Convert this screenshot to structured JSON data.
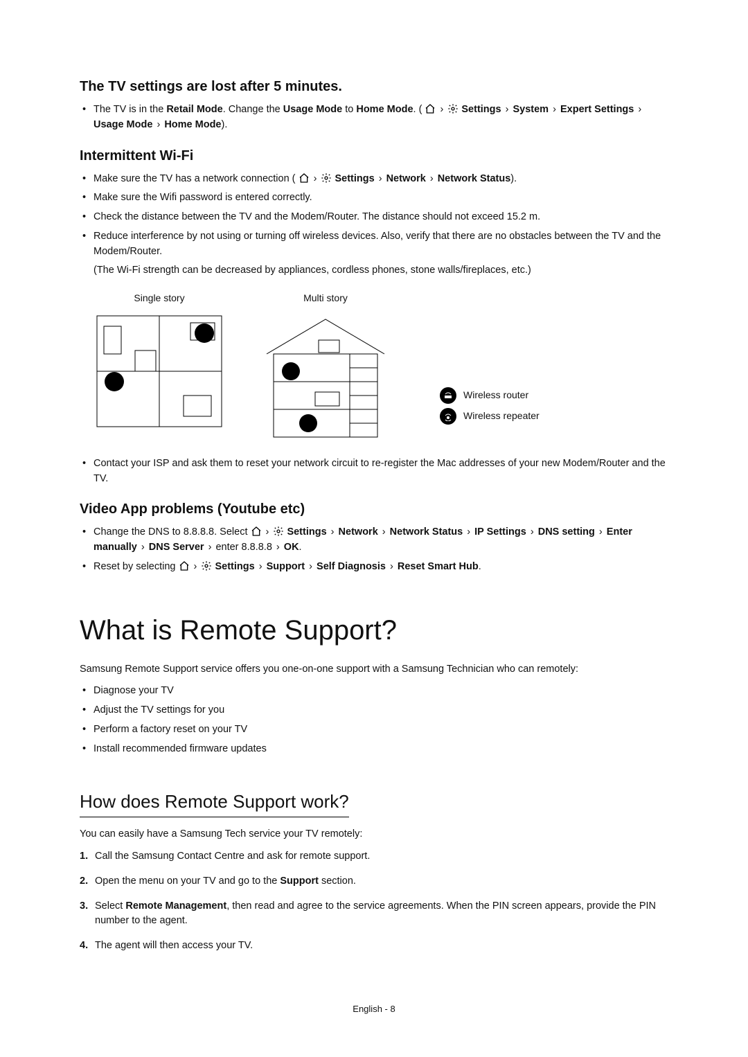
{
  "section1": {
    "heading": "The TV settings are lost after 5 minutes.",
    "bullets": [
      {
        "pre": "The TV is in the ",
        "b1": "Retail Mode",
        "mid1": ". Change the ",
        "b2": "Usage Mode",
        "mid2": " to ",
        "b3": "Home Mode",
        "mid3": ". (",
        "path": [
          "Settings",
          "System",
          "Expert Settings",
          "Usage Mode",
          "Home Mode"
        ],
        "post": ")."
      }
    ]
  },
  "section2": {
    "heading": "Intermittent Wi-Fi",
    "bullets": [
      {
        "pre": "Make sure the TV has a network connection (",
        "path": [
          "Settings",
          "Network",
          "Network Status"
        ],
        "post": ")."
      },
      {
        "text": "Make sure the Wifi password is entered correctly."
      },
      {
        "text": "Check the distance between the TV and the Modem/Router. The distance should not exceed 15.2 m."
      },
      {
        "text": "Reduce interference by not using or turning off wireless devices. Also, verify that there are no obstacles between the TV and the Modem/Router.",
        "sub": "(The Wi-Fi strength can be decreased by appliances, cordless phones, stone walls/fireplaces, etc.)"
      }
    ],
    "diagram_labels": {
      "single": "Single story",
      "multi": "Multi story"
    },
    "legend": {
      "router": "Wireless router",
      "repeater": "Wireless repeater"
    },
    "tail_bullet": "Contact your ISP and ask them to reset your network circuit to re-register the Mac addresses of your new Modem/Router and the TV."
  },
  "section3": {
    "heading": "Video App problems (Youtube etc)",
    "bullets": [
      {
        "pre": "Change the DNS to 8.8.8.8. Select ",
        "path": [
          "Settings",
          "Network",
          "Network Status",
          "IP Settings",
          "DNS setting",
          "Enter manually",
          "DNS Server"
        ],
        "post_pre": " enter 8.8.8.8 ",
        "post_b": "OK",
        "post": "."
      },
      {
        "pre": "Reset by selecting ",
        "path": [
          "Settings",
          "Support",
          "Self Diagnosis",
          "Reset Smart Hub"
        ],
        "post": "."
      }
    ]
  },
  "section4": {
    "heading": "What is Remote Support?",
    "intro": "Samsung Remote Support service offers you one-on-one support with a Samsung Technician who can remotely:",
    "bullets": [
      "Diagnose your TV",
      "Adjust the TV settings for you",
      "Perform a factory reset on your TV",
      "Install recommended firmware updates"
    ]
  },
  "section5": {
    "heading": "How does Remote Support work?",
    "intro": "You can easily have a Samsung Tech service your TV remotely:",
    "steps": [
      {
        "text": "Call the Samsung Contact Centre and ask for remote support."
      },
      {
        "pre": "Open the menu on your TV and go to the ",
        "b": "Support",
        "post": " section."
      },
      {
        "pre": "Select ",
        "b": "Remote Management",
        "post": ", then read and agree to the service agreements. When the PIN screen appears, provide the PIN number to the agent."
      },
      {
        "text": "The agent will then access your TV."
      }
    ]
  },
  "footer": "English - 8"
}
